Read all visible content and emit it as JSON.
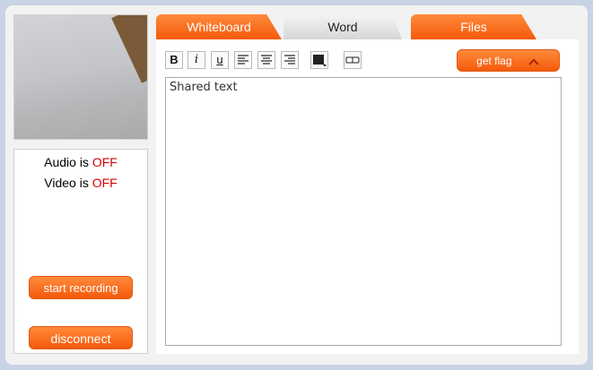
{
  "left": {
    "audio_prefix": "Audio is ",
    "audio_state": "OFF",
    "video_prefix": "Video is ",
    "video_state": "OFF",
    "start_recording_label": "start recording",
    "disconnect_label": "disconnect"
  },
  "tabs": [
    {
      "label": "Whiteboard"
    },
    {
      "label": "Word"
    },
    {
      "label": "Files"
    }
  ],
  "toolbar": {
    "bold": "B",
    "italic": "i",
    "underline": "u",
    "get_flag_label": "get flag"
  },
  "editor": {
    "text": "Shared text"
  },
  "colors": {
    "accent": "#f55a0a",
    "off": "#d40000"
  }
}
